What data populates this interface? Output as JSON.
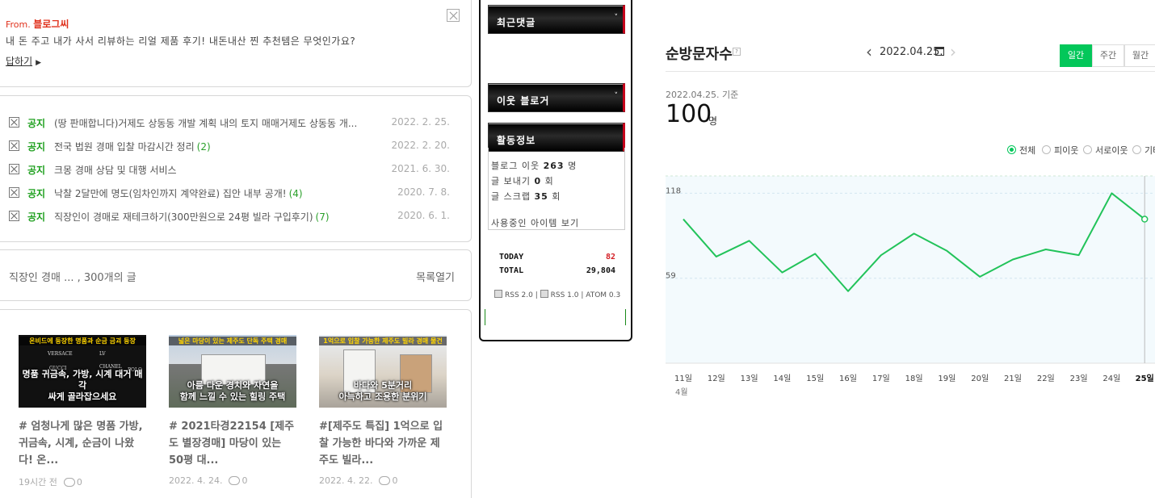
{
  "reply": {
    "from_prefix": "From.",
    "from_name": "블로그씨",
    "question": "내 돈 주고 내가 사서 리뷰하는 리얼 제품 후기! 내돈내산 찐 추천템은 무엇인가요?",
    "reply_label": "답하기"
  },
  "notices": [
    {
      "tag": "공지",
      "title": "(땅 판매합니다)거제도 상동동 개발 계획 내의 토지 매매거제도 상동동 개...",
      "count": "",
      "date": "2022. 2. 25."
    },
    {
      "tag": "공지",
      "title": "전국 법원 경매 입찰 마감시간 정리",
      "count": "(2)",
      "date": "2022. 2. 20."
    },
    {
      "tag": "공지",
      "title": "크몽 경매 상담 및 대행 서비스",
      "count": "",
      "date": "2021. 6. 30."
    },
    {
      "tag": "공지",
      "title": "낙찰 2달만에 명도(임차인까지 계약완료) 집안 내부 공개!",
      "count": "(4)",
      "date": "2020. 7. 8."
    },
    {
      "tag": "공지",
      "title": "직장인이 경매로 재테크하기(300만원으로 24평 빌라 구입후기)",
      "count": "(7)",
      "date": "2020. 6. 1."
    }
  ],
  "post_list": {
    "summary": "직장인 경매 ... , 300개의 글",
    "open_label": "목록열기"
  },
  "posts": [
    {
      "thumb_top": "온비드에 등장한 명품과 순금 금괴 등장",
      "thumb_caption": "명품 귀금속, 가방, 시계 대거 매각\n싸게 골라잡으세요",
      "title": "# 엄청나게 많은 명품 가방, 귀금속, 시계, 순금이 나왔다! 온...",
      "time": "19시간 전",
      "comments": "0"
    },
    {
      "thumb_top": "넓은 마당이 있는 제주도 단독 주택 경매",
      "thumb_caption": "아름 다운 경치와 자연을\n함께 느낄 수 있는 힐링 주택",
      "title": "# 2021타경22154 [제주도 별장경매] 마당이 있는 50평 대...",
      "time": "2022. 4. 24.",
      "comments": "0"
    },
    {
      "thumb_top": "1억으로 입찰 가능한 제주도 빌라 경매 물건",
      "thumb_caption": "바다와 5분거리\n아늑하고 조용한 분위기",
      "title": "#[제주도 특집] 1억으로 입찰 가능한 바다와 가까운 제주도 빌라...",
      "time": "2022. 4. 22.",
      "comments": "0"
    }
  ],
  "sidebar": {
    "recent_comments": "최근댓글",
    "neighbor_blogger": "이웃 블로거",
    "activity": "활동정보",
    "neighbors_label": "블로그 이웃",
    "neighbors_value": "263",
    "neighbors_unit": "명",
    "send_label": "글 보내기",
    "send_value": "0",
    "send_unit": "회",
    "scrap_label": "글 스크랩",
    "scrap_value": "35",
    "scrap_unit": "회",
    "items_link": "사용중인 아이템 보기",
    "today_label": "TODAY",
    "today_value": "82",
    "total_label": "TOTAL",
    "total_value": "29,804",
    "rss2": "RSS 2.0",
    "rss1": "RSS 1.0",
    "atom": "ATOM 0.3"
  },
  "stats": {
    "title": "순방문자수",
    "help": "?",
    "date": "2022.04.25.",
    "periods": [
      "일간",
      "주간",
      "월간"
    ],
    "active_period": "일간",
    "basis": "2022.04.25. 기준",
    "value": "100",
    "unit": "명",
    "legend": [
      "전체",
      "피이웃",
      "서로이웃",
      "기타"
    ],
    "accent": "#03c75a"
  },
  "chart_data": {
    "type": "line",
    "x": [
      "11일",
      "12일",
      "13일",
      "14일",
      "15일",
      "16일",
      "17일",
      "18일",
      "19일",
      "20일",
      "21일",
      "22일",
      "23일",
      "24일",
      "25일"
    ],
    "month_label": "4월",
    "series": [
      {
        "values": [
          100,
          74,
          85,
          63,
          76,
          50,
          75,
          90,
          78,
          60,
          72,
          79,
          75,
          118,
          100
        ]
      }
    ],
    "y_ticks": [
      118,
      59
    ],
    "ylim": [
      0,
      118
    ],
    "line_color": "#22c35a",
    "fill_color": "#f3fafd"
  }
}
